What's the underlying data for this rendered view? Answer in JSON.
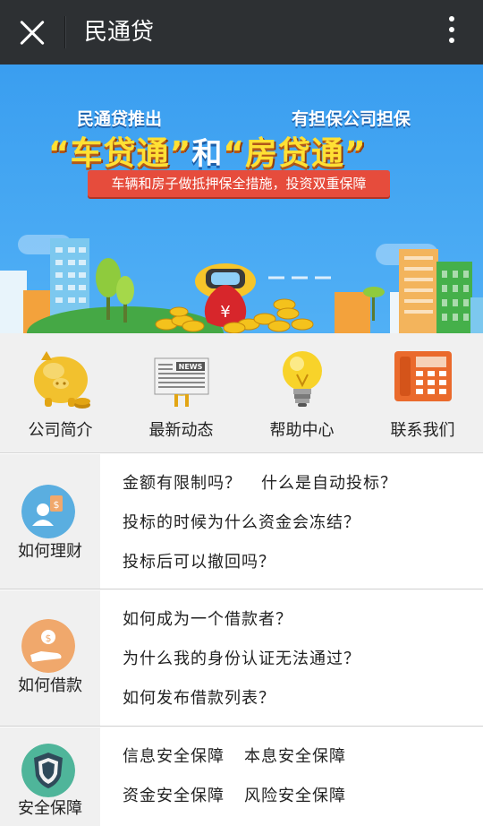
{
  "titlebar": {
    "title": "民通贷",
    "close_icon": "close-icon",
    "more_icon": "more-vertical-icon"
  },
  "banner": {
    "line_left": "民通贷推出",
    "line_right": "有担保公司担保",
    "product_a": "“车贷通”",
    "conj": "和",
    "product_b": "“房贷通”",
    "ribbon": "车辆和房子做抵押保全措施，投资双重保障"
  },
  "nav": [
    {
      "label": "公司简介",
      "icon": "piggy-bank-icon"
    },
    {
      "label": "最新动态",
      "icon": "newspaper-icon"
    },
    {
      "label": "帮助中心",
      "icon": "lightbulb-icon"
    },
    {
      "label": "联系我们",
      "icon": "telephone-icon"
    }
  ],
  "sections": [
    {
      "label": "如何理财",
      "icon": "investor-icon",
      "color": "#5aaee0",
      "questions": [
        [
          "金额有限制吗？",
          "什么是自动投标？"
        ],
        [
          "投标的时候为什么资金会冻结？"
        ],
        [
          "投标后可以撤回吗？"
        ]
      ]
    },
    {
      "label": "如何借款",
      "icon": "hand-money-icon",
      "color": "#f0a86c",
      "questions": [
        [
          "如何成为一个借款者？"
        ],
        [
          "为什么我的身份认证无法通过？"
        ],
        [
          "如何发布借款列表？"
        ]
      ]
    },
    {
      "label": "安全保障",
      "icon": "shield-icon",
      "color": "#4fb59a",
      "questions": [
        [
          "信息安全保障",
          "本息安全保障"
        ],
        [
          "资金安全保障",
          "风险安全保障"
        ]
      ]
    }
  ],
  "colors": {
    "titlebar_bg": "#2d3033",
    "banner_bg": "#3a9ef0",
    "ribbon_bg": "#e64c3c",
    "gray_bg": "#f0f0f0"
  }
}
